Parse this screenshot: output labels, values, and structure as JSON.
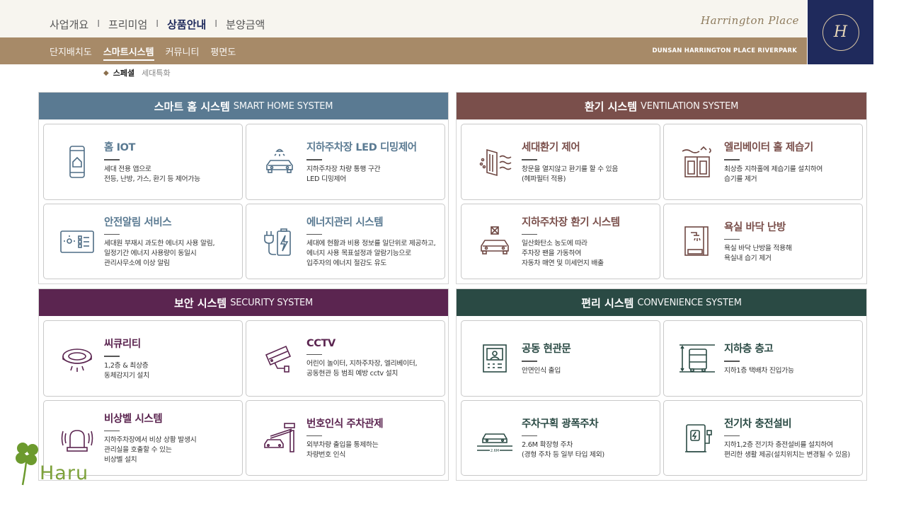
{
  "nav": {
    "main": [
      "사업개요",
      "프리미엄",
      "상품안내",
      "분양금액"
    ],
    "main_active": 2,
    "separator": "I",
    "sub": [
      "단지배치도",
      "스마트시스템",
      "커뮤니티",
      "평면도"
    ],
    "sub_active": 1
  },
  "brand": {
    "script_name": "Harrington Place",
    "site_name": "DUNSAN HARRINGTON PLACE RIVERPARK",
    "logo_monogram": "H"
  },
  "breadcrumb": {
    "current": "스페셜",
    "sub": "세대특화"
  },
  "colors": {
    "smart": "#5a7a92",
    "vent": "#7a4f4b",
    "sec": "#5b2550",
    "conv": "#2a4a44",
    "nav_navy": "#1f2a5c",
    "nav_gold": "#a78a68"
  },
  "panels": {
    "smart": {
      "title_ko": "스마트 홈 시스템",
      "title_en": "SMART HOME SYSTEM",
      "cards": [
        {
          "title": "홈 IOT",
          "desc": [
            "세대 전용 앱으로",
            "전등, 난방, 가스, 환기 등 제어가능"
          ],
          "icon": "phone-home-icon"
        },
        {
          "title": "지하주차장 LED 디밍제어",
          "desc": [
            "지하주차장 차량 통행 구간",
            "LED 디밍제어"
          ],
          "icon": "car-lamp-icon"
        },
        {
          "title": "안전알림 서비스",
          "desc": [
            "세대원 부재시 과도한 에너지 사용 알림,",
            "일정기간 에너지 사용량이 동일시",
            "관리사무소에 이상 알림"
          ],
          "icon": "energy-monitor-icon"
        },
        {
          "title": "에너지관리 시스템",
          "desc": [
            "세대에 현황과 비용 정보를 일단위로 제공하고,",
            "에너지 사용 목표설정과 알람기능으로",
            "입주자의 에너지 절감도 유도"
          ],
          "icon": "plug-battery-icon"
        }
      ]
    },
    "vent": {
      "title_ko": "환기 시스템",
      "title_en": "VENTILATION SYSTEM",
      "cards": [
        {
          "title": "세대환기 제어",
          "desc": [
            "창문을 열지않고 환기를 할 수 있음",
            "(헤파필터 적용)"
          ],
          "icon": "air-filter-icon"
        },
        {
          "title": "엘리베이터 홀 제습기",
          "desc": [
            "최상층 지하홀에 제습기를 설치하여",
            "습기를 제거"
          ],
          "icon": "elevator-icon"
        },
        {
          "title": "지하주차장 환기 시스템",
          "desc": [
            "일산화탄소 농도에 따라",
            "주차장 팬을 가동하여",
            "자동차 매연 및 미세먼지 배출"
          ],
          "icon": "parking-fan-icon"
        },
        {
          "title": "욕실 바닥 난방",
          "desc": [
            "욕실 바닥 난방을 적용해",
            "욕실내 습기 제거"
          ],
          "icon": "shower-icon"
        }
      ]
    },
    "sec": {
      "title_ko": "보안 시스템",
      "title_en": "SECURITY SYSTEM",
      "cards": [
        {
          "title": "씨큐리티",
          "desc": [
            "1,2층 & 최상층",
            "동체감지기 설치"
          ],
          "icon": "motion-sensor-icon"
        },
        {
          "title": "CCTV",
          "desc": [
            "어린이 놀이터, 지하주차장, 엘리베이터,",
            "공동현관 등 범죄 예방 cctv 설치"
          ],
          "icon": "cctv-icon"
        },
        {
          "title": "비상벨 시스템",
          "desc": [
            "지하주차장에서 비상 상황 발생시",
            "관리실을 호출할 수 있는",
            "비상벨 설치"
          ],
          "icon": "alarm-bell-icon"
        },
        {
          "title": "번호인식 주차관제",
          "desc": [
            "외부차량 출입을 통제하는",
            "차량번호 인식"
          ],
          "icon": "parking-gate-icon"
        }
      ]
    },
    "conv": {
      "title_ko": "편리 시스템",
      "title_en": "CONVENIENCE SYSTEM",
      "cards": [
        {
          "title": "공동 현관문",
          "desc": [
            "안면인식 출입"
          ],
          "icon": "face-door-icon"
        },
        {
          "title": "지하층 층고",
          "desc": [
            "지하1층 택배차 진입가능"
          ],
          "icon": "truck-height-icon"
        },
        {
          "title": "주차구획 광폭주차",
          "desc": [
            "2.6M 확장형 주차",
            "(경형 주차 등 일부 타입 제외)"
          ],
          "icon": "wide-parking-icon",
          "badge": "2.6M"
        },
        {
          "title": "전기차 충전설비",
          "desc": [
            "지하1,2층 전기차 충전설비를 설치하여",
            "편리한 생활 제공(설치위치는 변경될 수 있음)"
          ],
          "icon": "ev-charger-icon"
        }
      ]
    }
  },
  "watermark": {
    "text": "Haru",
    "icon": "clover-icon"
  }
}
